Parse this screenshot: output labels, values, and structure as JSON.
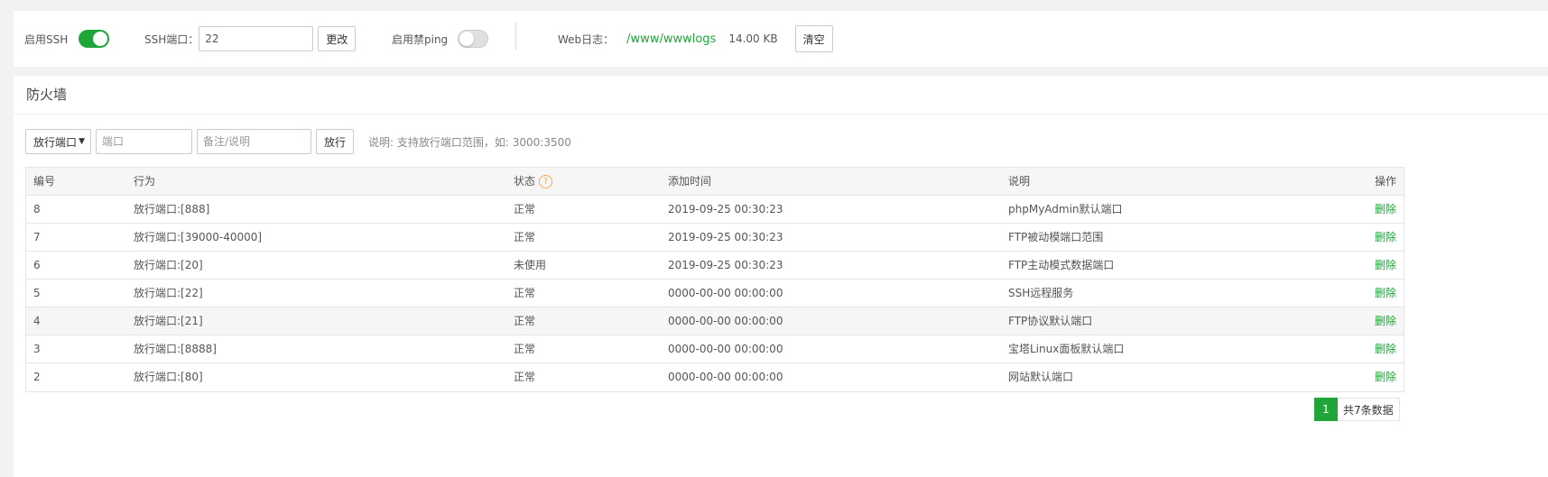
{
  "topbar": {
    "ssh_label": "启用SSH",
    "ssh_enabled": true,
    "ssh_port_label": "SSH端口：",
    "ssh_port_value": "22",
    "change_button": "更改",
    "ping_label": "启用禁ping",
    "ping_enabled": false,
    "weblog_label": "Web日志：",
    "weblog_path": "/www/wwwlogs",
    "weblog_size": "14.00 KB",
    "clear_button": "清空"
  },
  "firewall": {
    "title": "防火墙",
    "select_value": "放行端口",
    "port_placeholder": "端口",
    "note_placeholder": "备注/说明",
    "allow_button": "放行",
    "hint": "说明: 支持放行端口范围，如: 3000:3500",
    "columns": [
      "编号",
      "行为",
      "状态",
      "添加时间",
      "说明",
      "操作"
    ],
    "rows": [
      {
        "id": "8",
        "action": "放行端口:[888]",
        "status": "正常",
        "time": "2019-09-25 00:30:23",
        "note": "phpMyAdmin默认端口",
        "op": "删除"
      },
      {
        "id": "7",
        "action": "放行端口:[39000-40000]",
        "status": "正常",
        "time": "2019-09-25 00:30:23",
        "note": "FTP被动模端口范围",
        "op": "删除"
      },
      {
        "id": "6",
        "action": "放行端口:[20]",
        "status": "未使用",
        "time": "2019-09-25 00:30:23",
        "note": "FTP主动模式数据端口",
        "op": "删除"
      },
      {
        "id": "5",
        "action": "放行端口:[22]",
        "status": "正常",
        "time": "0000-00-00 00:00:00",
        "note": "SSH远程服务",
        "op": "删除"
      },
      {
        "id": "4",
        "action": "放行端口:[21]",
        "status": "正常",
        "time": "0000-00-00 00:00:00",
        "note": "FTP协议默认端口",
        "op": "删除"
      },
      {
        "id": "3",
        "action": "放行端口:[8888]",
        "status": "正常",
        "time": "0000-00-00 00:00:00",
        "note": "宝塔Linux面板默认端口",
        "op": "删除"
      },
      {
        "id": "2",
        "action": "放行端口:[80]",
        "status": "正常",
        "time": "0000-00-00 00:00:00",
        "note": "网站默认端口",
        "op": "删除"
      }
    ],
    "pagination": {
      "current": "1",
      "total_text": "共7条数据"
    }
  },
  "colors": {
    "accent": "#20a53a",
    "help_icon": "#f0ad4e"
  }
}
